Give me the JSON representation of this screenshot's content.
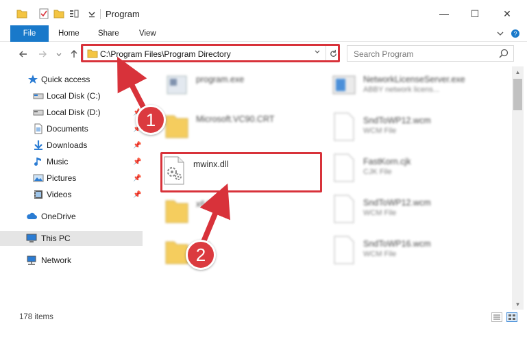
{
  "window": {
    "title": "Program",
    "controls": {
      "minimize": "—",
      "maximize": "☐",
      "close": "✕"
    }
  },
  "ribbon": {
    "tabs": [
      "File",
      "Home",
      "Share",
      "View"
    ]
  },
  "nav": {
    "address": "C:\\Program Files\\Program Directory",
    "search_placeholder": "Search Program"
  },
  "sidebar": {
    "items": [
      {
        "label": "Quick access",
        "icon": "star-icon"
      },
      {
        "label": "Local Disk (C:)",
        "icon": "drive-icon"
      },
      {
        "label": "Local Disk (D:)",
        "icon": "drive-icon"
      },
      {
        "label": "Documents",
        "icon": "documents-icon"
      },
      {
        "label": "Downloads",
        "icon": "download-icon"
      },
      {
        "label": "Music",
        "icon": "music-icon"
      },
      {
        "label": "Pictures",
        "icon": "pictures-icon"
      },
      {
        "label": "Videos",
        "icon": "videos-icon"
      },
      {
        "label": "OneDrive",
        "icon": "cloud-icon"
      },
      {
        "label": "This PC",
        "icon": "computer-icon"
      },
      {
        "label": "Network",
        "icon": "network-icon"
      }
    ]
  },
  "files": {
    "left": [
      {
        "name": "program.exe",
        "desc": ""
      },
      {
        "name": "Microsoft.VC90.CRT",
        "desc": ""
      },
      {
        "name": "mwinx.dll",
        "desc": ""
      },
      {
        "name": "x64",
        "desc": ""
      },
      {
        "name": "x86",
        "desc": ""
      }
    ],
    "right": [
      {
        "name": "NetworkLicenseServer.exe",
        "desc": "ABBY network licens..."
      },
      {
        "name": "SndToWP12.wcm",
        "desc": "WCM File"
      },
      {
        "name": "FastKorn.cjk",
        "desc": "CJK File"
      },
      {
        "name": "SndToWP12.wcm",
        "desc": "WCM File"
      },
      {
        "name": "SndToWP16.wcm",
        "desc": "WCM File"
      }
    ]
  },
  "status": {
    "item_count": "178 items"
  },
  "annotations": {
    "step1": "1",
    "step2": "2"
  },
  "colors": {
    "accent": "#1979ca",
    "highlight": "#d8323a",
    "badge": "#db3a3f",
    "folder": "#f4c542"
  }
}
